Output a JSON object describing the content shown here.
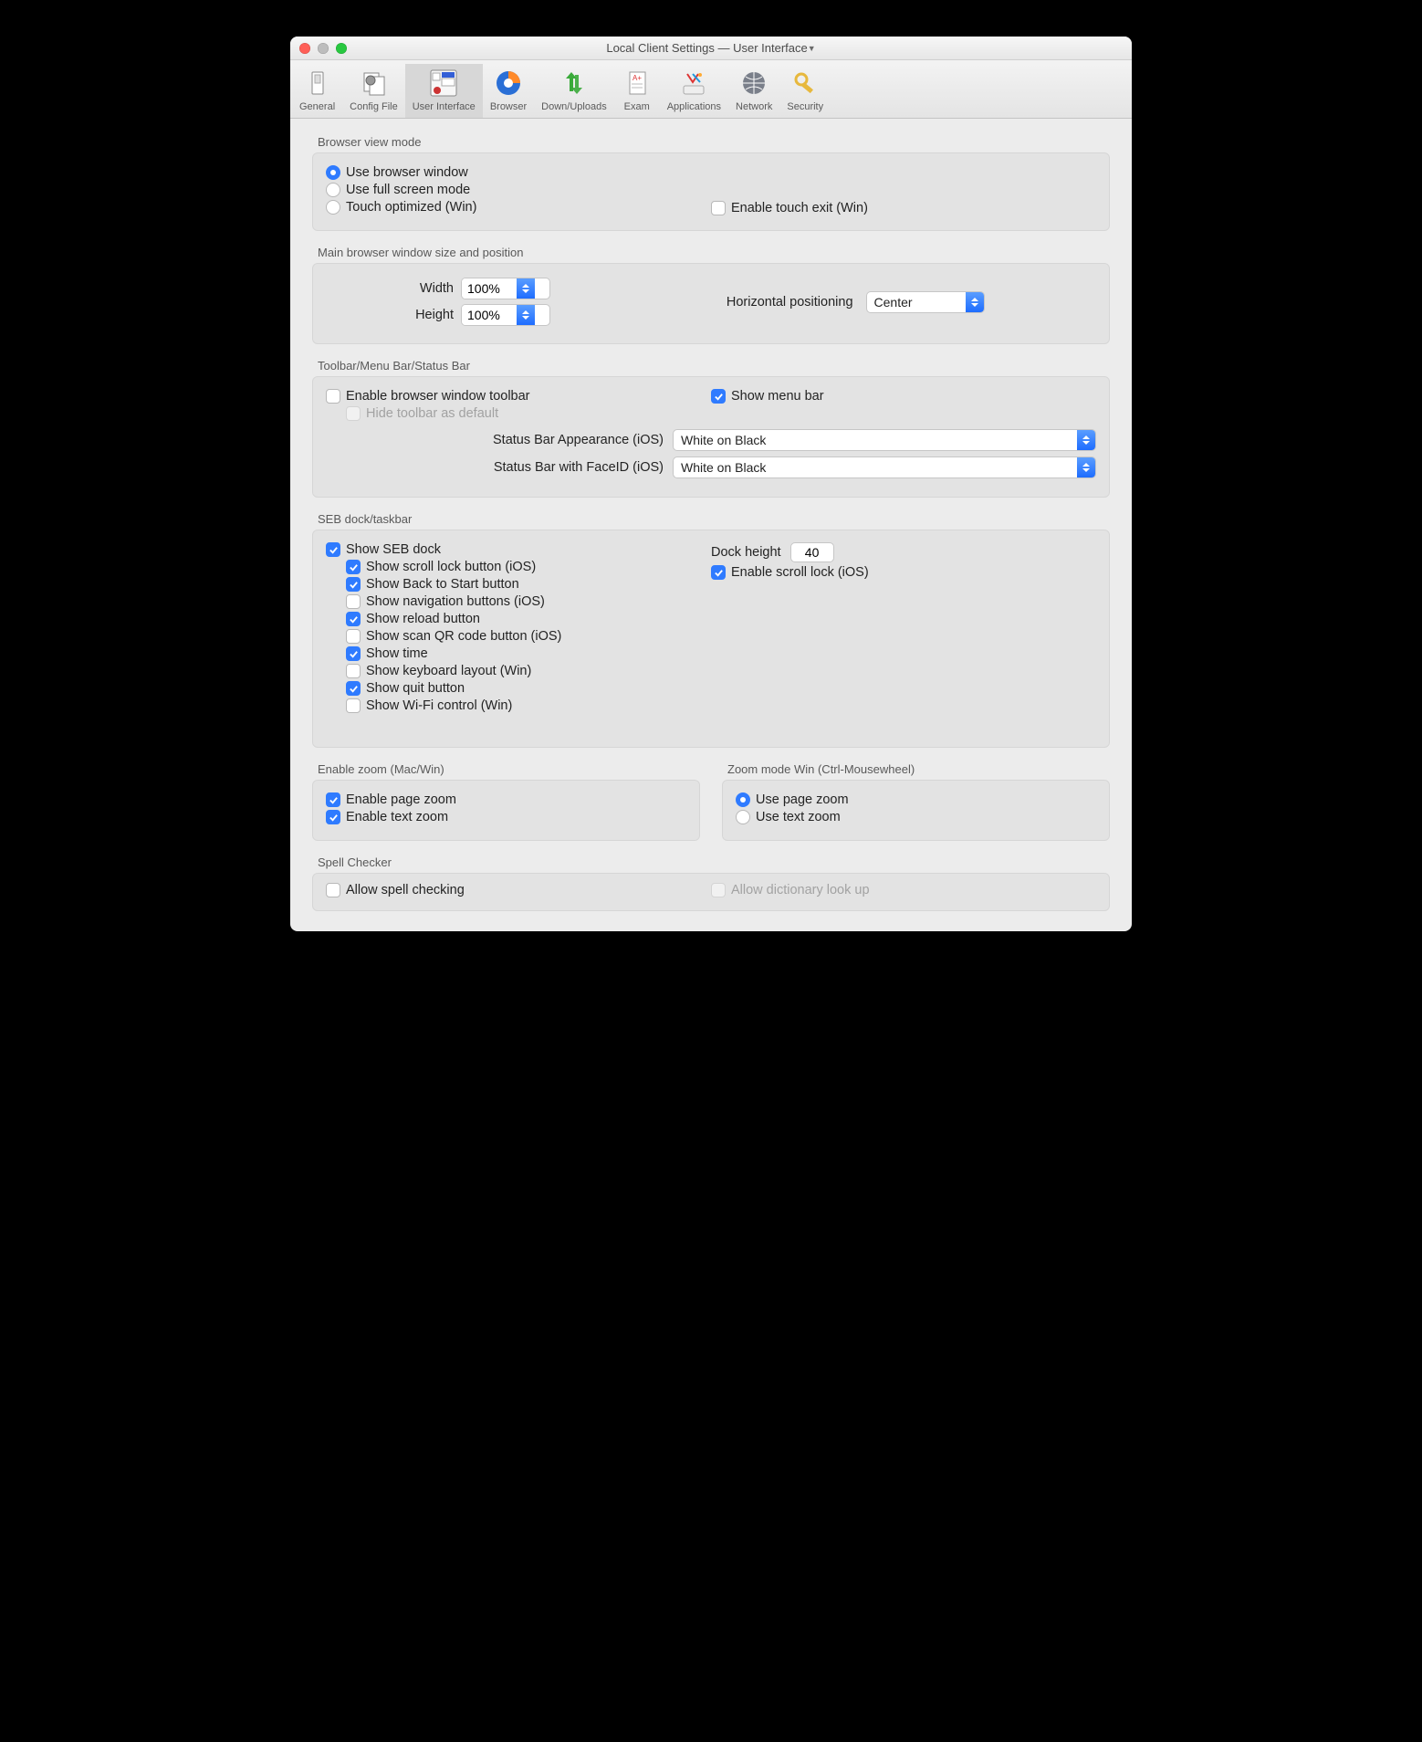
{
  "window_title": "Local Client Settings  —  User Interface",
  "toolbar": {
    "items": [
      {
        "label": "General"
      },
      {
        "label": "Config File"
      },
      {
        "label": "User Interface"
      },
      {
        "label": "Browser"
      },
      {
        "label": "Down/Uploads"
      },
      {
        "label": "Exam"
      },
      {
        "label": "Applications"
      },
      {
        "label": "Network"
      },
      {
        "label": "Security"
      }
    ],
    "selected_index": 2
  },
  "browser_view": {
    "section": "Browser view mode",
    "use_browser_window": "Use browser window",
    "use_full_screen": "Use full screen mode",
    "touch_optimized": "Touch optimized (Win)",
    "enable_touch_exit": "Enable touch exit (Win)",
    "selected": "use_browser_window"
  },
  "main_window": {
    "section": "Main browser window size and position",
    "width_label": "Width",
    "height_label": "Height",
    "width_value": "100%",
    "height_value": "100%",
    "hpos_label": "Horizontal positioning",
    "hpos_value": "Center"
  },
  "bars": {
    "section": "Toolbar/Menu Bar/Status Bar",
    "enable_toolbar": "Enable browser window toolbar",
    "hide_default": "Hide toolbar as default",
    "show_menu": "Show menu bar",
    "status_ios_label": "Status Bar Appearance (iOS)",
    "status_ios_value": "White on Black",
    "status_faceid_label": "Status Bar with FaceID (iOS)",
    "status_faceid_value": "White on Black",
    "enable_toolbar_on": false,
    "show_menu_on": true
  },
  "dock": {
    "section": "SEB dock/taskbar",
    "show_dock": "Show SEB dock",
    "show_scroll_lock": "Show scroll lock button (iOS)",
    "show_back": "Show Back to Start button",
    "show_nav": "Show navigation buttons (iOS)",
    "show_reload": "Show reload button",
    "show_qr": "Show scan QR code button (iOS)",
    "show_time": "Show time",
    "show_kbd": "Show keyboard layout (Win)",
    "show_quit": "Show quit button",
    "show_wifi": "Show Wi-Fi control (Win)",
    "dock_height_label": "Dock height",
    "dock_height_value": "40",
    "enable_scroll_lock": "Enable scroll lock (iOS)"
  },
  "zoom": {
    "enable_section": "Enable zoom (Mac/Win)",
    "page_zoom": "Enable page zoom",
    "text_zoom": "Enable text zoom",
    "mode_section": "Zoom mode Win (Ctrl-Mousewheel)",
    "use_page": "Use page zoom",
    "use_text": "Use text zoom"
  },
  "spell": {
    "section": "Spell Checker",
    "allow_spell": "Allow spell checking",
    "allow_dict": "Allow dictionary look up"
  }
}
